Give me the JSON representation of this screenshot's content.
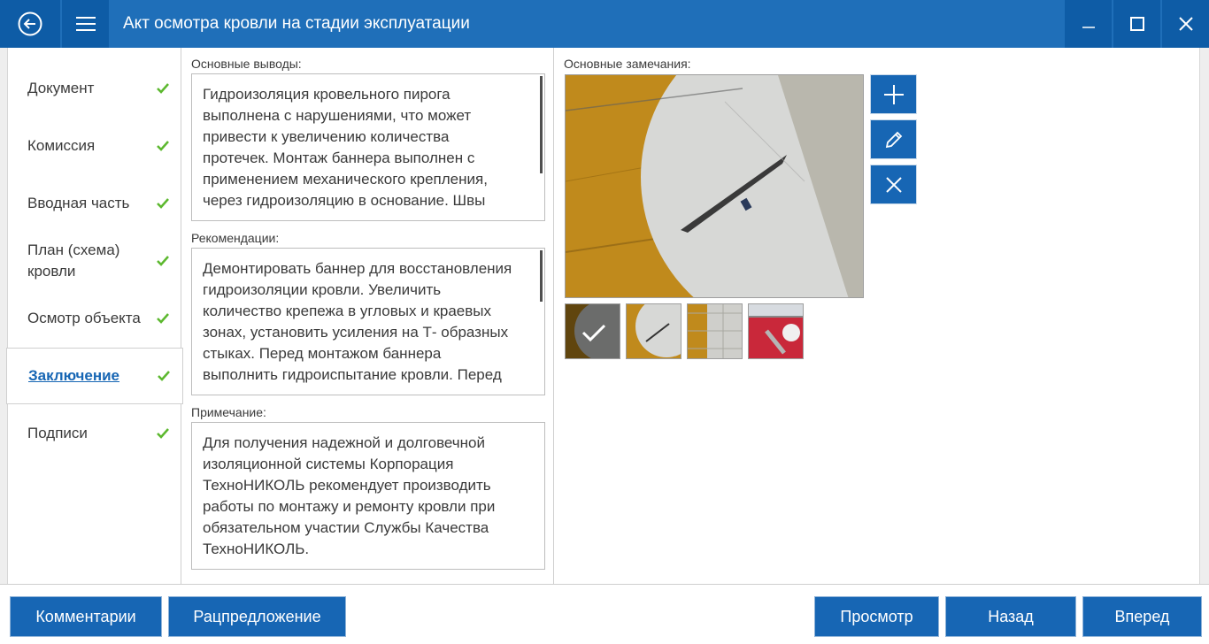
{
  "window": {
    "title": "Акт осмотра кровли на стадии эксплуатации",
    "icons": {
      "back": "back-arrow-icon",
      "menu": "hamburger-menu-icon",
      "minimize": "minimize-icon",
      "maximize": "maximize-icon",
      "close": "close-icon"
    }
  },
  "sidebar": {
    "items": [
      {
        "label": "Документ",
        "done": true,
        "active": false
      },
      {
        "label": "Комиссия",
        "done": true,
        "active": false
      },
      {
        "label": "Вводная часть",
        "done": true,
        "active": false
      },
      {
        "label": "План (схема)\nкровли",
        "done": true,
        "active": false
      },
      {
        "label": "Осмотр объекта",
        "done": true,
        "active": false
      },
      {
        "label": "Заключение",
        "done": true,
        "active": true
      },
      {
        "label": "Подписи",
        "done": true,
        "active": false
      }
    ]
  },
  "conclusions": {
    "label": "Основные выводы:",
    "text": "Гидроизоляция кровельного пирога\nвыполнена с нарушениями, что может\nпривести к увеличению количества\nпротечек. Монтаж баннера выполнен с\nприменением механического крепления,\nчерез гидроизоляцию в основание. Швы"
  },
  "recommendations": {
    "label": "Рекомендации:",
    "text": "Демонтировать баннер для восстановления\nгидроизоляции кровли. Увеличить\nколичество крепежа в угловых и краевых\nзонах, установить усиления на Т- образных\nстыках. Перед монтажом баннера\nвыполнить гидроиспытание кровли. Перед"
  },
  "note": {
    "label": "Примечание:",
    "text": "Для получения надежной и долговечной\nизоляционной системы Корпорация\nТехноНИКОЛЬ рекомендует производить\nработы по монтажу и ремонту кровли при\nобязательном участии Службы Качества\nТехноНИКОЛЬ."
  },
  "remarks": {
    "label": "Основные замечания:",
    "actions": {
      "add": "plus-icon",
      "edit": "pencil-icon",
      "delete": "cross-icon"
    },
    "thumbnail_count": 4,
    "selected_thumbnail": 1
  },
  "footer": {
    "comments": "Комментарии",
    "proposal": "Рацпредложение",
    "preview": "Просмотр",
    "back": "Назад",
    "forward": "Вперед"
  },
  "colors": {
    "titlebar": "#1f6fb9",
    "button": "#1766b4",
    "check": "#5cb82e"
  }
}
